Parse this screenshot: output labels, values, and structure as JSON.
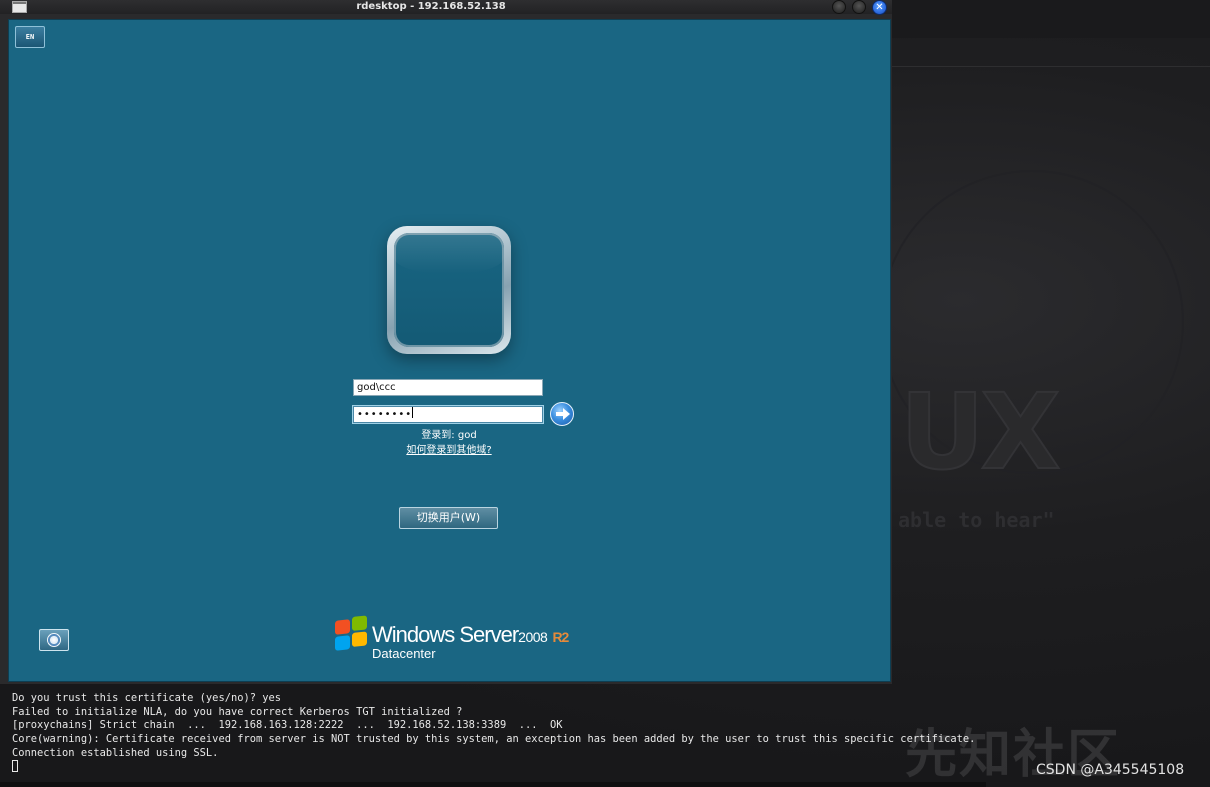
{
  "window": {
    "title": "rdesktop - 192.168.52.138",
    "close_glyph": "✕"
  },
  "remote": {
    "language_badge": "EN",
    "username_value": "god\\ccc",
    "password_value": "••••••••",
    "login_to": "登录到: god",
    "other_domain_link": "如何登录到其他域?",
    "switch_user_label": "切换用户(W)",
    "logo": {
      "brand": "Windows Server",
      "version": "2008",
      "release": "R2",
      "edition": "Datacenter"
    }
  },
  "background": {
    "logo_text": "UX",
    "slogan": "able to hear\""
  },
  "terminal": {
    "lines": [
      "Do you trust this certificate (yes/no)? yes",
      "Failed to initialize NLA, do you have correct Kerberos TGT initialized ?",
      "[proxychains] Strict chain  ...  192.168.163.128:2222  ...  192.168.52.138:3389  ...  OK",
      "Core(warning): Certificate received from server is NOT trusted by this system, an exception has been added by the user to trust this specific certificate.",
      "Connection established using SSL."
    ]
  },
  "watermarks": {
    "site_logo": "先知社区",
    "csdn": "CSDN @A345545108"
  },
  "colors": {
    "remote_bg": "#1a6683",
    "r2_accent": "#e58a3a",
    "close_button": "#2d6ce0"
  },
  "icons": [
    "window-menu-icon",
    "minimize-icon",
    "maximize-icon",
    "close-icon",
    "submit-arrow-icon",
    "ease-of-access-icon",
    "windows-flag-icon"
  ]
}
